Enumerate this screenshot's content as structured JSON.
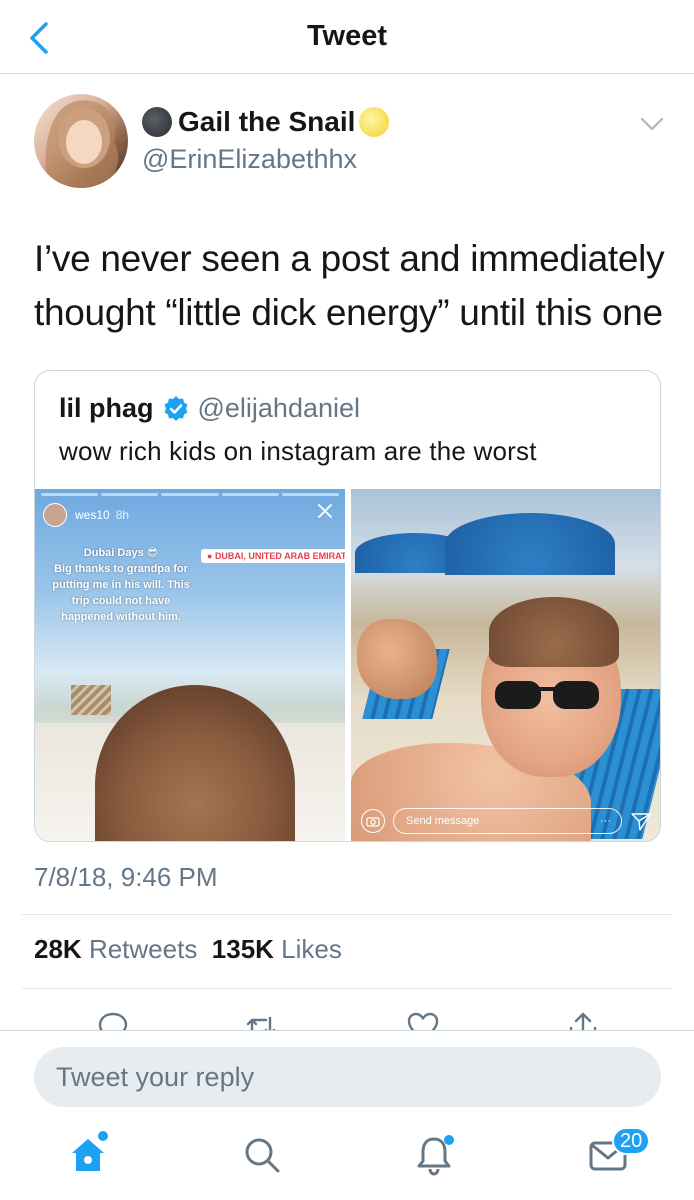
{
  "header": {
    "title": "Tweet"
  },
  "tweet": {
    "author": {
      "display_name": "Gail the Snail",
      "handle": "@ErinElizabethhx"
    },
    "text": "I’ve never seen a post and immediately thought “little dick energy” until this one",
    "timestamp": "7/8/18, 9:46 PM",
    "retweets_count": "28K",
    "retweets_label": "Retweets",
    "likes_count": "135K",
    "likes_label": "Likes"
  },
  "quote": {
    "display_name": "lil phag",
    "handle": "@elijahdaniel",
    "text": "wow rich kids on instagram are the worst",
    "story": {
      "username": "wes10",
      "time": "8h",
      "caption_title": "Dubai Days 😎",
      "caption": "Big thanks to grandpa for putting me in his will. This trip could not have happened without him.",
      "location": "DUBAI, UNITED ARAB EMIRATES",
      "send_placeholder": "Send message",
      "more": "···"
    }
  },
  "reply": {
    "placeholder": "Tweet your reply"
  },
  "tabbar": {
    "messages_badge": "20"
  },
  "colors": {
    "accent": "#1da1f2",
    "secondary_text": "#657786",
    "divider": "#e1e8ed"
  },
  "icons": [
    "back-icon",
    "chevron-down-icon",
    "verified-icon",
    "reply-icon",
    "retweet-icon",
    "like-icon",
    "share-icon",
    "home-icon",
    "search-icon",
    "notifications-icon",
    "messages-icon"
  ]
}
